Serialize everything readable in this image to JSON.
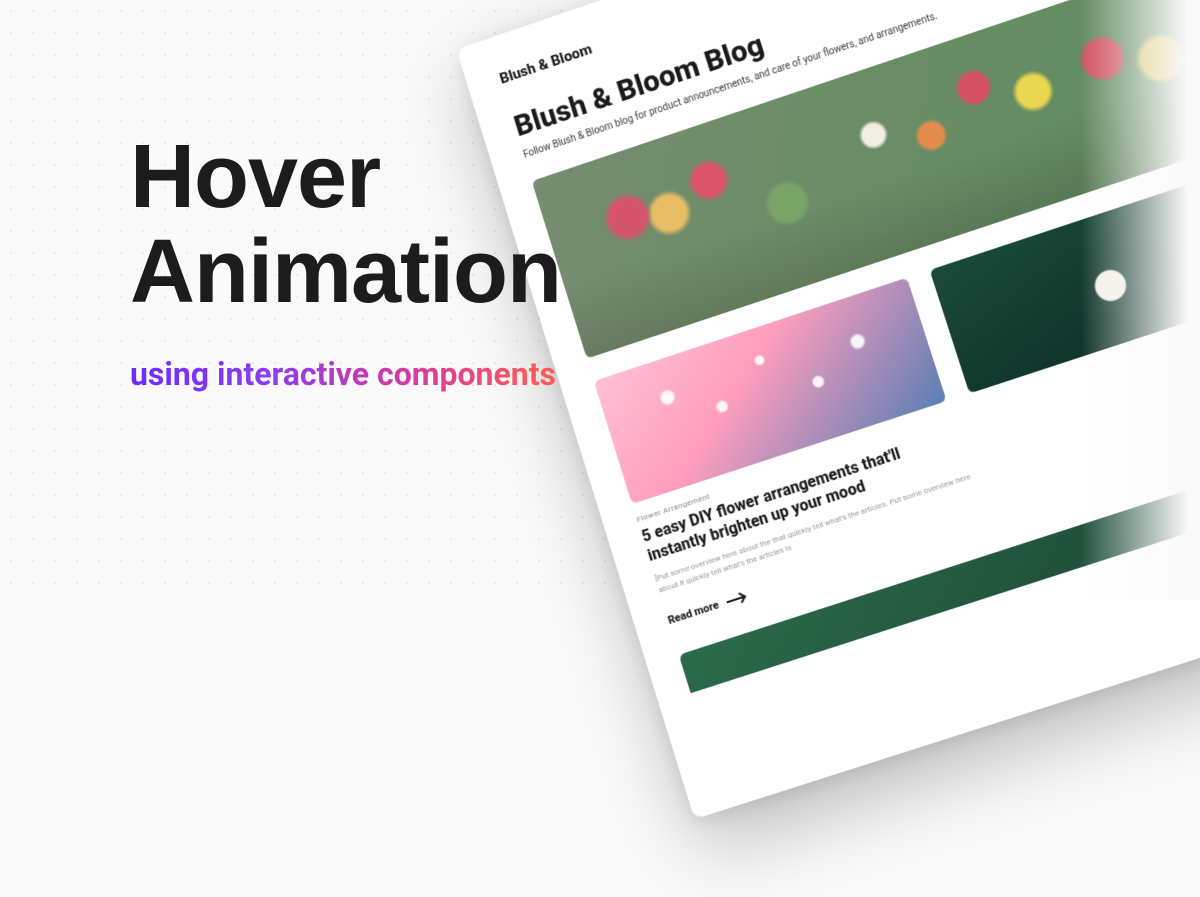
{
  "promo": {
    "headline_line1": "Hover",
    "headline_line2": "Animation",
    "subhead": "using interactive components"
  },
  "mock": {
    "brand": "Blush & Bloom",
    "icon": "rose-icon",
    "hero_title": "Blush & Bloom Blog",
    "hero_sub": "Follow Blush & Bloom blog for product announcements, and care of your flowers, and arrangements.",
    "card": {
      "category": "Flower Arrangement",
      "title": "5 easy DIY flower arrangements that'll instantly brighten up your mood",
      "excerpt": "[Put some overview here about the that quickly tell what's the articles. Put some overview here about it quickly tell what's the articles is",
      "cta": "Read more"
    }
  }
}
